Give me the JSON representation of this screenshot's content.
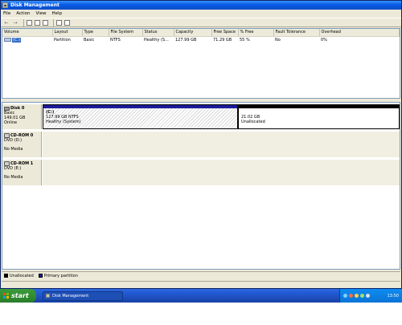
{
  "window": {
    "title": "Disk Management"
  },
  "menu": [
    "File",
    "Action",
    "View",
    "Help"
  ],
  "toolbar": {
    "icons": [
      "back-arrow-icon",
      "forward-arrow-icon",
      "console-icon",
      "properties-icon",
      "help-icon",
      "refresh-icon",
      "export-icon"
    ]
  },
  "volumes": {
    "columns": [
      "Volume",
      "Layout",
      "Type",
      "File System",
      "Status",
      "Capacity",
      "Free Space",
      "% Free",
      "Fault Tolerance",
      "Overhead"
    ],
    "rows": [
      [
        "(C:)",
        "Partition",
        "Basic",
        "NTFS",
        "Healthy (S...",
        "127.99 GB",
        "71.29 GB",
        "55 %",
        "No",
        "0%"
      ]
    ]
  },
  "disks": [
    {
      "name": "Disk 0",
      "lines": [
        "Basic",
        "149.01 GB",
        "Online"
      ]
    },
    {
      "name": "CD-ROM 0",
      "lines": [
        "DVD (D:)",
        "",
        "No Media"
      ]
    },
    {
      "name": "CD-ROM 1",
      "lines": [
        "DVD (E:)",
        "",
        "No Media"
      ]
    }
  ],
  "partitions": {
    "c": {
      "label": "(C:)",
      "size": "127.99 GB NTFS",
      "status": "Healthy (System)"
    },
    "unalloc": {
      "size": "21.02 GB",
      "status": "Unallocated"
    }
  },
  "legend": [
    "Unallocated",
    "Primary partition"
  ],
  "colors": {
    "unallocated": "#000000",
    "primary": "#1b1b9a"
  },
  "taskbar": {
    "start": "start",
    "task": "Disk Management",
    "clock": "13:50"
  }
}
